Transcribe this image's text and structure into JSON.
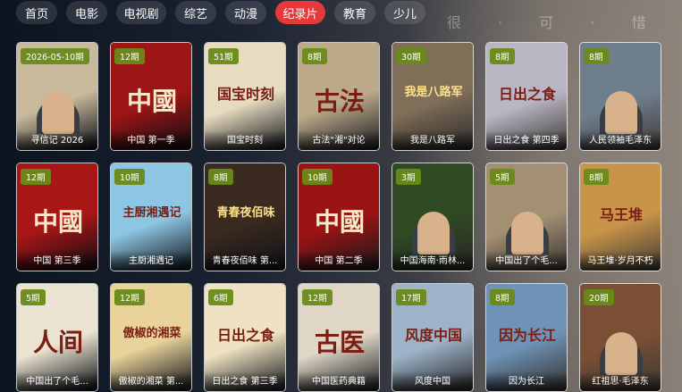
{
  "nav": {
    "tabs": [
      {
        "label": "首页",
        "active": false
      },
      {
        "label": "电影",
        "active": false
      },
      {
        "label": "电视剧",
        "active": false
      },
      {
        "label": "综艺",
        "active": false
      },
      {
        "label": "动漫",
        "active": false
      },
      {
        "label": "纪录片",
        "active": true
      },
      {
        "label": "教育",
        "active": false
      },
      {
        "label": "少儿",
        "active": false
      }
    ]
  },
  "watermark": "很 · 可 · 惜",
  "colors": {
    "active_tab": "#e63a3a",
    "badge": "#6a8a19"
  },
  "cards": [
    {
      "badge": "2026-05-10期",
      "title": "寻信记 2026",
      "poster_text": "",
      "bg": "#c9b99d"
    },
    {
      "badge": "12期",
      "title": "中国 第一季",
      "poster_text": "中國",
      "bg": "#9d1515"
    },
    {
      "badge": "51期",
      "title": "国宝时刻",
      "poster_text": "国宝时刻",
      "bg": "#e8dcc0"
    },
    {
      "badge": "8期",
      "title": "古法\"湘\"对论",
      "poster_text": "古法",
      "bg": "#bba98a"
    },
    {
      "badge": "30期",
      "title": "我是八路军",
      "poster_text": "我是八路军",
      "bg": "#7f6e58"
    },
    {
      "badge": "8期",
      "title": "日出之食 第四季",
      "poster_text": "日出之食",
      "bg": "#b9b6c4"
    },
    {
      "badge": "8期",
      "title": "人民领袖毛泽东",
      "poster_text": "",
      "bg": "#6f7e8d"
    },
    {
      "badge": "12期",
      "title": "中国 第三季",
      "poster_text": "中國",
      "bg": "#a91616"
    },
    {
      "badge": "10期",
      "title": "主厨湘遇记",
      "poster_text": "主厨湘遇记",
      "bg": "#8dc6e2"
    },
    {
      "badge": "8期",
      "title": "青春夜佰味 第...",
      "poster_text": "青春夜佰味",
      "bg": "#3a2a1f"
    },
    {
      "badge": "10期",
      "title": "中国 第二季",
      "poster_text": "中國",
      "bg": "#9a1414"
    },
    {
      "badge": "3期",
      "title": "中国海南·雨林...",
      "poster_text": "",
      "bg": "#2f4a22"
    },
    {
      "badge": "5期",
      "title": "中国出了个毛...",
      "poster_text": "",
      "bg": "#a38f72"
    },
    {
      "badge": "8期",
      "title": "马王堆·岁月不朽",
      "poster_text": "马王堆",
      "bg": "#c89448"
    },
    {
      "badge": "5期",
      "title": "中国出了个毛...",
      "poster_text": "人间",
      "bg": "#ebe3d2"
    },
    {
      "badge": "12期",
      "title": "傲椒的湘菜 第...",
      "poster_text": "傲椒的湘菜",
      "bg": "#e9d39b"
    },
    {
      "badge": "6期",
      "title": "日出之食 第三季",
      "poster_text": "日出之食",
      "bg": "#efe2c2"
    },
    {
      "badge": "12期",
      "title": "中国医药典籍",
      "poster_text": "古医",
      "bg": "#dfd6c6"
    },
    {
      "badge": "17期",
      "title": "风度中国",
      "poster_text": "风度中国",
      "bg": "#9eb3c8"
    },
    {
      "badge": "8期",
      "title": "因为长江",
      "poster_text": "因为长江",
      "bg": "#6f93b6"
    },
    {
      "badge": "20期",
      "title": "红祖思·毛泽东",
      "poster_text": "",
      "bg": "#7b4f35"
    }
  ]
}
